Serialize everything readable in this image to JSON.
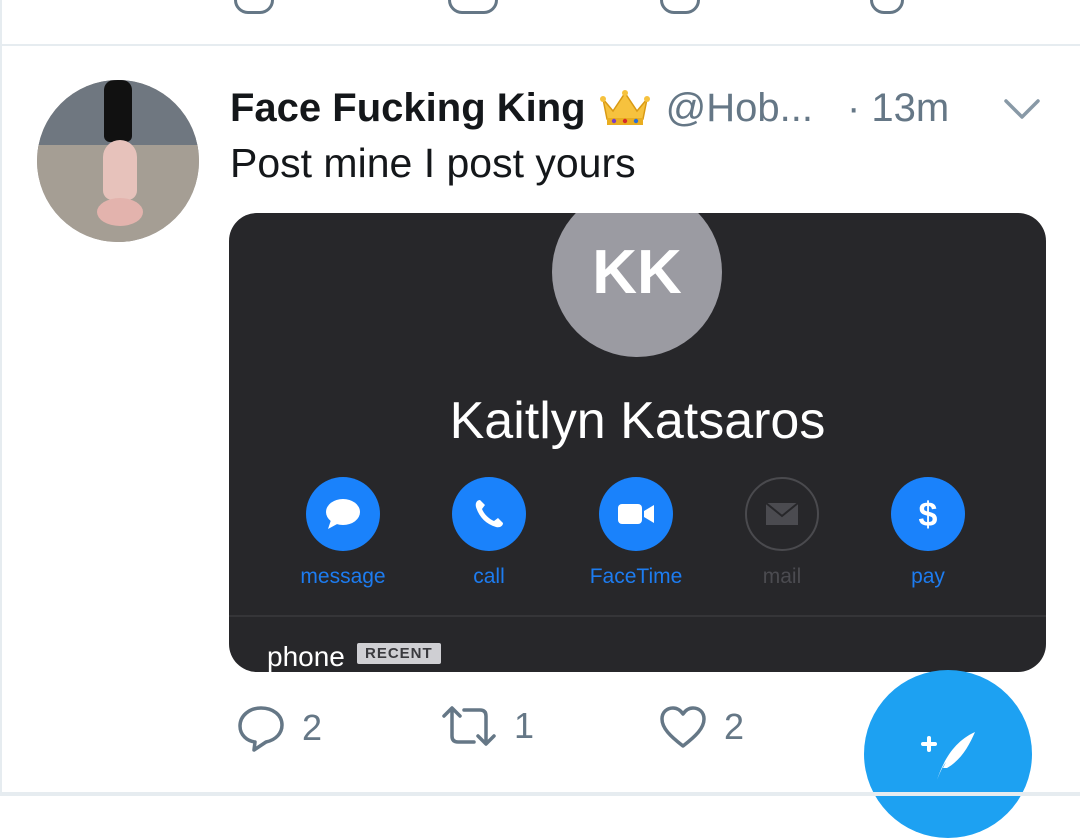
{
  "tweet": {
    "display_name": "Face Fucking King",
    "handle": "@Hob...",
    "time": "· 13m",
    "text": "Post mine I post yours",
    "badge_icon": "crown-emoji",
    "stats": {
      "replies": "2",
      "retweets": "1",
      "likes": "2"
    }
  },
  "media": {
    "initials": "KK",
    "contact_name": "Kaitlyn Katsaros",
    "actions": [
      {
        "label": "message",
        "icon": "message-bubble-icon"
      },
      {
        "label": "call",
        "icon": "phone-icon"
      },
      {
        "label": "FaceTime",
        "icon": "video-camera-icon"
      },
      {
        "label": "mail",
        "icon": "envelope-icon"
      },
      {
        "label": "pay",
        "icon": "dollar-icon"
      }
    ],
    "phone_label": "phone",
    "recent_badge": "RECENT"
  },
  "colors": {
    "twitter_blue": "#1da1f2",
    "ios_blue": "#1a82fb",
    "muted_text": "#657786",
    "card_bg": "#27272a"
  }
}
